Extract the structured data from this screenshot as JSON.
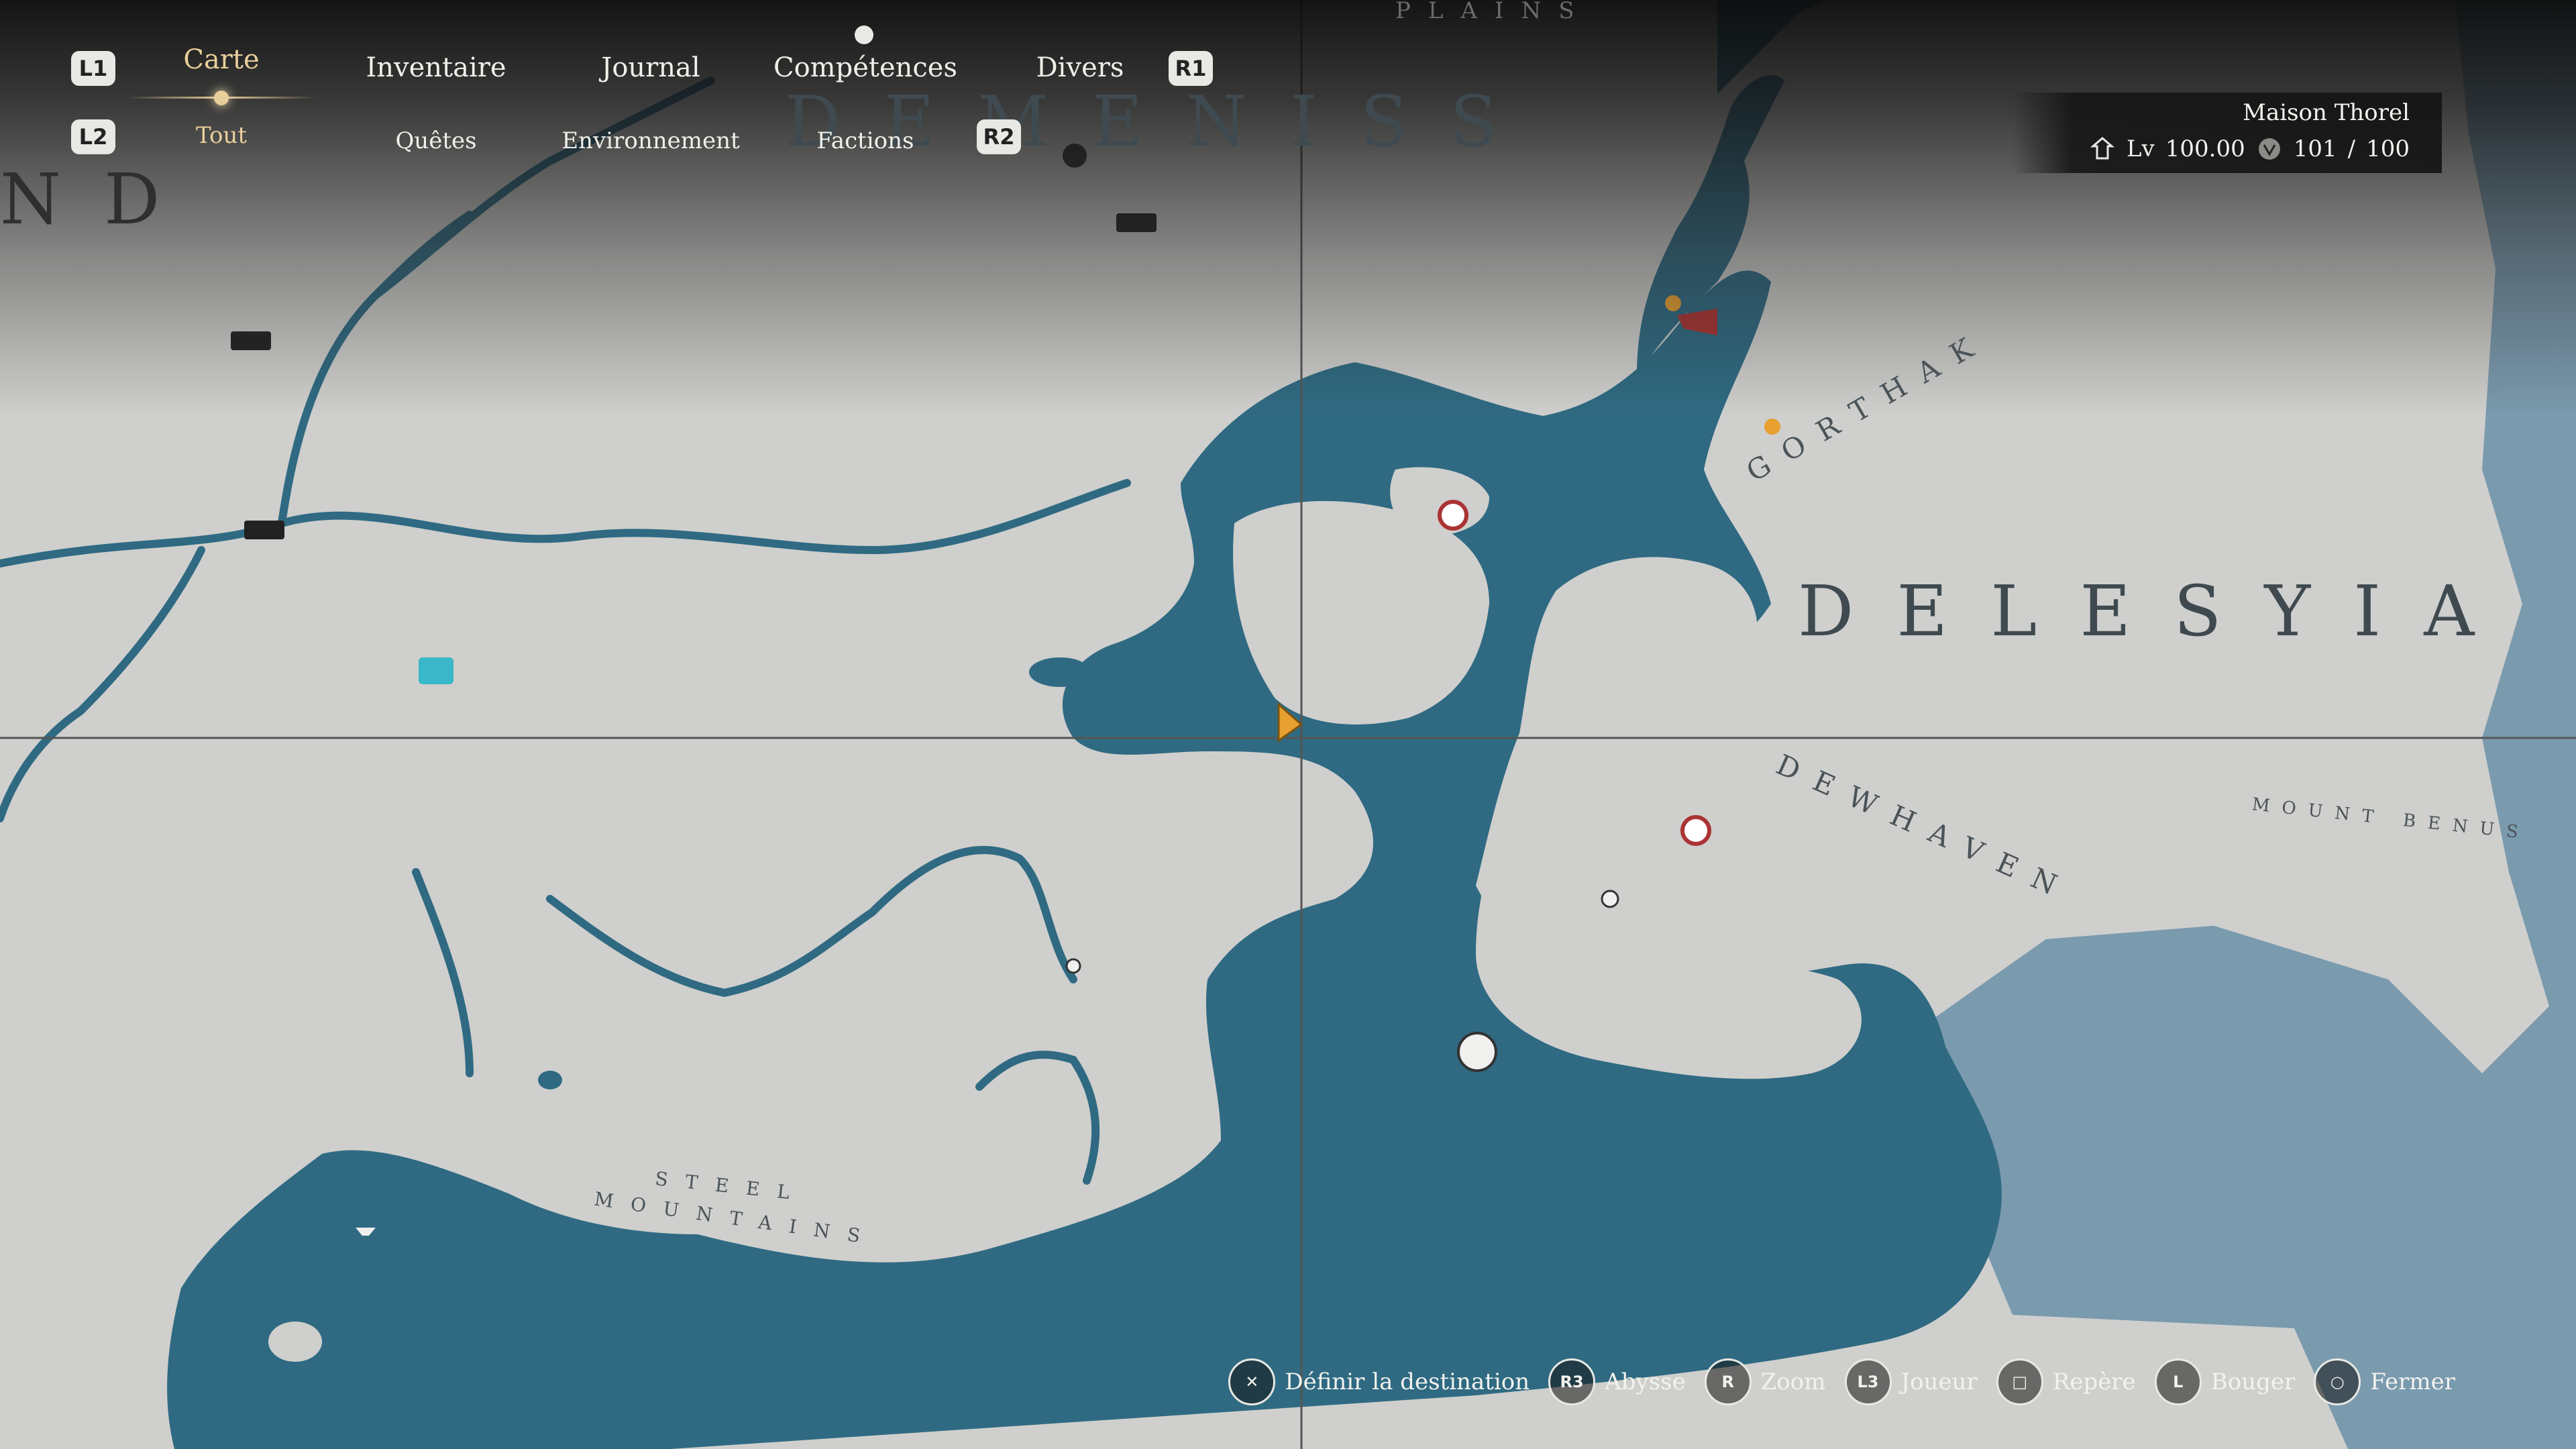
{
  "colors": {
    "land": "#cfcfcd",
    "water": "#2f6a82",
    "ocean_far": "#7a9aae",
    "accent": "#e8cf9a",
    "panel": "#181818"
  },
  "top_tabs": {
    "left_key": "L1",
    "right_key": "R1",
    "items": [
      {
        "label": "Carte",
        "active": true
      },
      {
        "label": "Inventaire",
        "active": false
      },
      {
        "label": "Journal",
        "active": false
      },
      {
        "label": "Compétences",
        "active": false
      },
      {
        "label": "Divers",
        "active": false
      }
    ]
  },
  "sub_tabs": {
    "left_key": "L2",
    "right_key": "R2",
    "items": [
      {
        "label": "Tout",
        "active": true
      },
      {
        "label": "Quêtes",
        "active": false
      },
      {
        "label": "Environnement",
        "active": false
      },
      {
        "label": "Factions",
        "active": false
      }
    ]
  },
  "player_panel": {
    "name": "Maison Thorel",
    "level_label": "Lv",
    "level_value": "100.00",
    "count": "101",
    "separator": "/",
    "max": "100"
  },
  "map_labels": {
    "demeniss": "DEMENISS",
    "nd": "ND",
    "plains": "PLAINS",
    "gorthak": "GORTHAK",
    "delesyia": "DELESYIA",
    "dewhaven": "DEWHAVEN",
    "mount_benus": "MOUNT BENUS",
    "steel": "STEEL",
    "mountains": "MOUNTAINS"
  },
  "hints": [
    {
      "button": "✕",
      "label": "Définir la destination"
    },
    {
      "button": "R3",
      "label": "Abysse"
    },
    {
      "button": "R",
      "label": "Zoom"
    },
    {
      "button": "L3",
      "label": "Joueur"
    },
    {
      "button": "□",
      "label": "Repère"
    },
    {
      "button": "L",
      "label": "Bouger"
    },
    {
      "button": "○",
      "label": "Fermer"
    }
  ]
}
